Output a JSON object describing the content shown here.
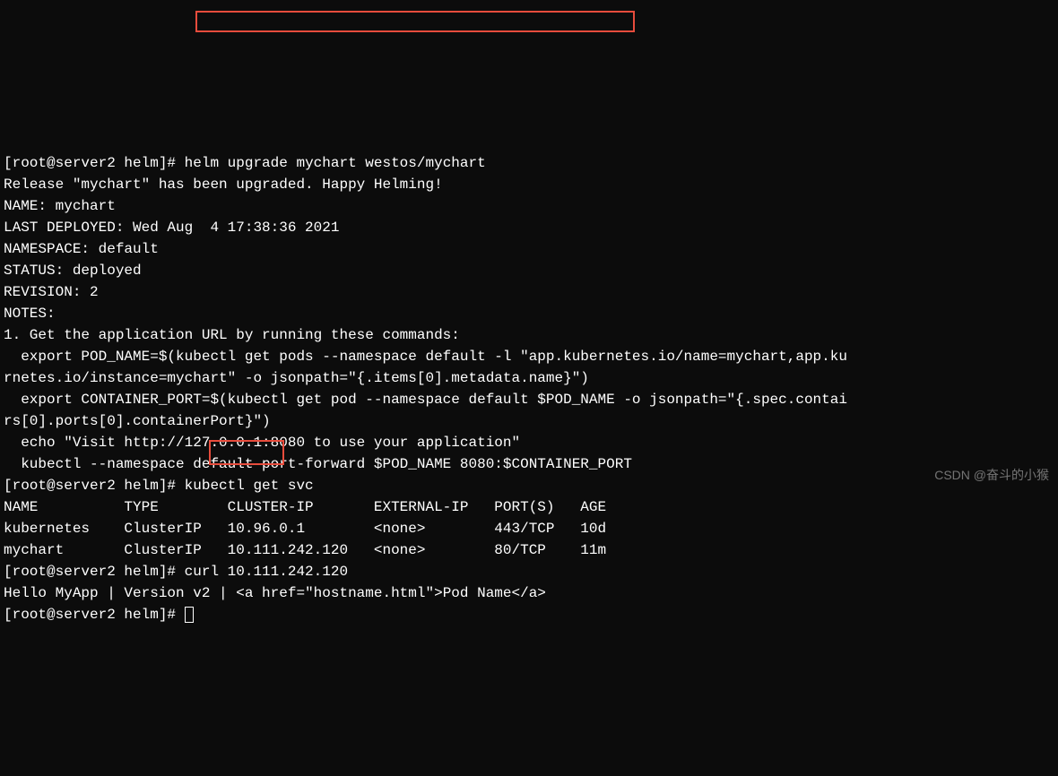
{
  "lines": {
    "l0a": "[root@server2 helm]# ",
    "l0b": "helm upgrade mychart westos/mychart",
    "l1": "Release \"mychart\" has been upgraded. Happy Helming!",
    "l2": "NAME: mychart",
    "l3": "LAST DEPLOYED: Wed Aug  4 17:38:36 2021",
    "l4": "NAMESPACE: default",
    "l5": "STATUS: deployed",
    "l6": "REVISION: 2",
    "l7": "NOTES:",
    "l8": "1. Get the application URL by running these commands:",
    "l9": "  export POD_NAME=$(kubectl get pods --namespace default -l \"app.kubernetes.io/name=mychart,app.ku",
    "l10": "rnetes.io/instance=mychart\" -o jsonpath=\"{.items[0].metadata.name}\")",
    "l11": "  export CONTAINER_PORT=$(kubectl get pod --namespace default $POD_NAME -o jsonpath=\"{.spec.contai",
    "l12": "rs[0].ports[0].containerPort}\")",
    "l13": "  echo \"Visit http://127.0.0.1:8080 to use your application\"",
    "l14": "  kubectl --namespace default port-forward $POD_NAME 8080:$CONTAINER_PORT",
    "l15": "[root@server2 helm]# kubectl get svc",
    "l16": "NAME          TYPE        CLUSTER-IP       EXTERNAL-IP   PORT(S)   AGE",
    "l17": "kubernetes    ClusterIP   10.96.0.1        <none>        443/TCP   10d",
    "l18": "mychart       ClusterIP   10.111.242.120   <none>        80/TCP    11m",
    "l19": "[root@server2 helm]# curl 10.111.242.120",
    "l20a": "Hello MyApp | Version",
    "l20b": " v2 ",
    "l20c": "| <a href=\"hostname.html\">Pod Name</a>",
    "l21": "[root@server2 helm]# "
  },
  "watermark": "CSDN @奋斗的小猴",
  "svc_table": {
    "headers": [
      "NAME",
      "TYPE",
      "CLUSTER-IP",
      "EXTERNAL-IP",
      "PORT(S)",
      "AGE"
    ],
    "rows": [
      {
        "name": "kubernetes",
        "type": "ClusterIP",
        "cluster_ip": "10.96.0.1",
        "external_ip": "<none>",
        "ports": "443/TCP",
        "age": "10d"
      },
      {
        "name": "mychart",
        "type": "ClusterIP",
        "cluster_ip": "10.111.242.120",
        "external_ip": "<none>",
        "ports": "80/TCP",
        "age": "11m"
      }
    ]
  },
  "commands": {
    "helm_upgrade": "helm upgrade mychart westos/mychart",
    "kubectl_get_svc": "kubectl get svc",
    "curl": "curl 10.111.242.120"
  },
  "release_info": {
    "name": "mychart",
    "last_deployed": "Wed Aug  4 17:38:36 2021",
    "namespace": "default",
    "status": "deployed",
    "revision": 2
  },
  "curl_response": {
    "text": "Hello MyApp",
    "version": "v2",
    "link_href": "hostname.html",
    "link_text": "Pod Name"
  }
}
